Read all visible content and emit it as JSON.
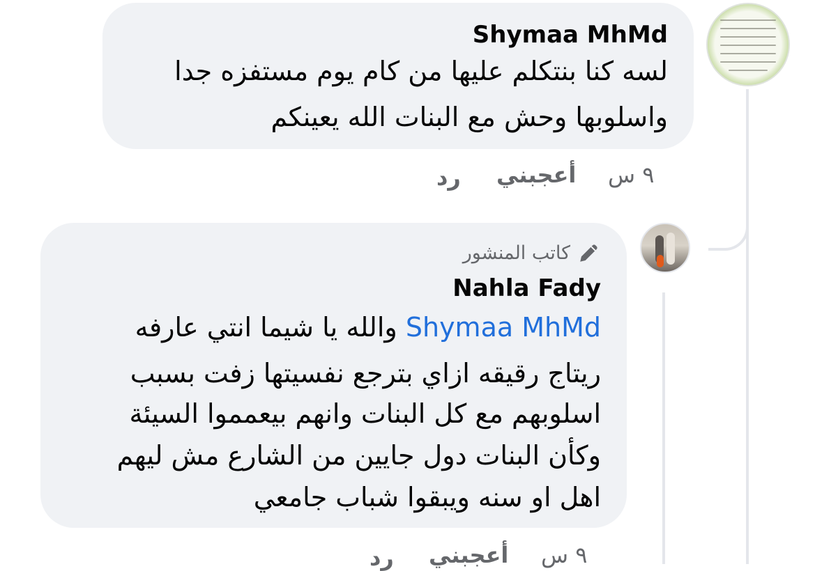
{
  "comments": [
    {
      "author": "Shymaa MhMd",
      "text_line1": "لسه كنا بنتكلم عليها من كام يوم مستفزه جدا",
      "text_line2": "واسلوبها وحش مع البنات الله يعينكم",
      "time": "٩ س",
      "like_label": "أعجبني",
      "reply_label": "رد",
      "avatar_icon": "avatar-image"
    },
    {
      "author_badge_icon": "pen-icon",
      "author_badge": "كاتب المنشور",
      "author": "Nahla Fady",
      "mention": "Shymaa MhMd",
      "text_after_mention": "والله يا شيما انتي عارفه",
      "text_lines": [
        "ريتاج رقيقه ازاي بترجع نفسيتها زفت بسبب",
        "اسلوبهم مع كل البنات وانهم بيعمموا السيئة",
        "وكأن البنات دول جايين من الشارع مش ليهم",
        "اهل او سنه ويبقوا شباب جامعي"
      ],
      "time": "٩ س",
      "like_label": "أعجبني",
      "reply_label": "رد"
    }
  ],
  "colors": {
    "bubble": "#f0f2f5",
    "meta": "#65676b",
    "mention": "#216fdb",
    "thread_line": "#e4e6eb"
  }
}
